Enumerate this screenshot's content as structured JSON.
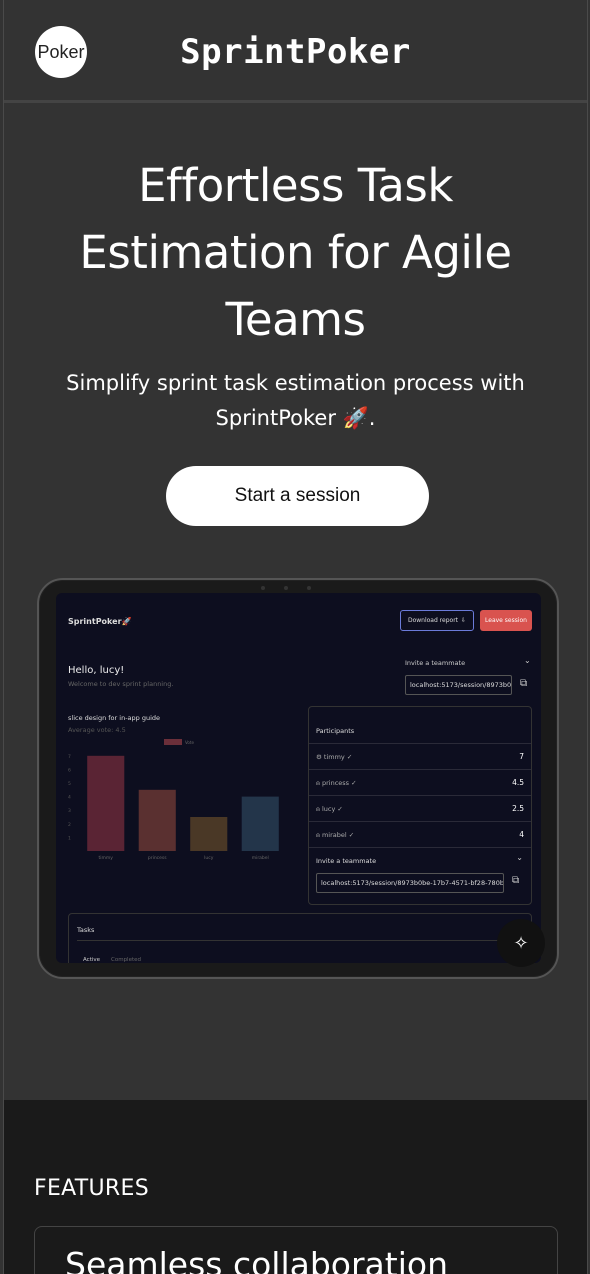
{
  "header": {
    "logo_text": "Poker",
    "brand": "SprintPoker"
  },
  "hero": {
    "title": "Effortless Task Estimation for Agile Teams",
    "subtitle": "Simplify sprint task estimation process with SprintPoker 🚀.",
    "cta_label": "Start a session"
  },
  "preview": {
    "brand": "SprintPoker🚀",
    "download_label": "Download report",
    "leave_label": "Leave session",
    "greeting": "Hello, lucy!",
    "welcome": "Welcome to dev sprint planning.",
    "invite_label": "Invite a teammate",
    "invite_url_top": "localhost:5173/session/8973b0",
    "task_title": "slice design for in-app guide",
    "average": "Average vote: 4.5",
    "legend": "Vote",
    "participants_title": "Participants",
    "participants": [
      {
        "name": "timmy ✓",
        "vote": "7",
        "icon": "gear-icon"
      },
      {
        "name": "princess ✓",
        "vote": "4.5",
        "icon": "user-icon"
      },
      {
        "name": "lucy ✓",
        "vote": "2.5",
        "icon": "user-icon"
      },
      {
        "name": "mirabel ✓",
        "vote": "4",
        "icon": "user-icon"
      }
    ],
    "invite_url": "localhost:5173/session/8973b0be-17b7-4571-bf28-780b7",
    "tasks_title": "Tasks",
    "tab_active": "Active",
    "tab_completed": "Completed"
  },
  "chart_data": {
    "type": "bar",
    "categories": [
      "timmy",
      "princess",
      "lucy",
      "mirabel"
    ],
    "values": [
      7,
      4.5,
      2.5,
      4
    ],
    "colors": [
      "#5a2434",
      "#5a3030",
      "#4a3826",
      "#23354a"
    ],
    "y_ticks": [
      1,
      2,
      3,
      4,
      5,
      6,
      7
    ],
    "ylim": [
      0,
      7.5
    ],
    "series": [
      {
        "name": "Vote",
        "values": [
          7,
          4.5,
          2.5,
          4
        ]
      }
    ]
  },
  "features": {
    "label": "FEATURES",
    "card_title": "Seamless collaboration"
  }
}
